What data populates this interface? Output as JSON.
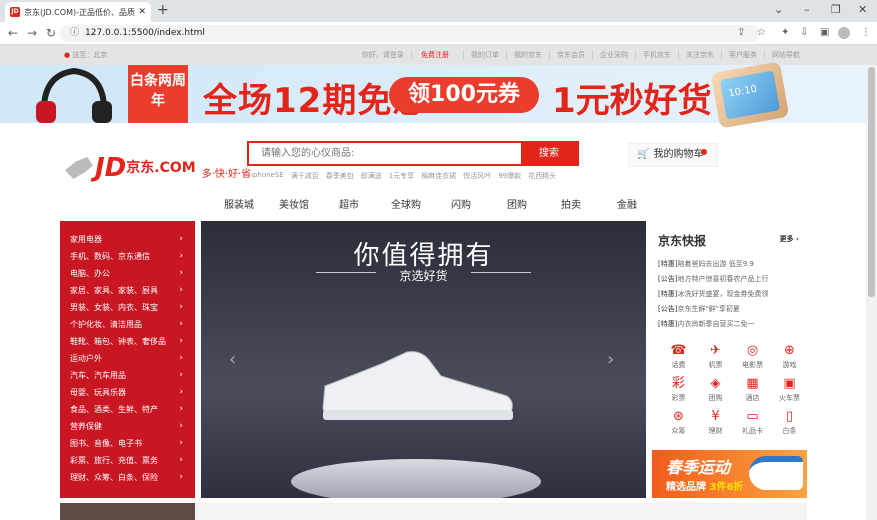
{
  "browser": {
    "tab_title": "京东(JD.COM)-正品低价、品质",
    "url": "127.0.0.1:5500/index.html"
  },
  "shortcut": {
    "location": "送至：北京",
    "greeting": "你好，请登录",
    "register": "免费注册",
    "links": [
      "我的订单",
      "我的京东",
      "京东会员",
      "企业采购",
      "手机京东",
      "关注京东",
      "客户服务",
      "网站导航"
    ]
  },
  "banner": {
    "badge": "白条两周年",
    "big": "全场12期免息",
    "coupon": "领100元券",
    "sec": "1元秒好货",
    "phone_time": "10:10"
  },
  "logo": {
    "jd": "JD",
    "com": "京东.COM",
    "slogan": "多·快·好·省"
  },
  "search": {
    "placeholder": "请输入您的心仪商品:",
    "button": "搜索",
    "hot": [
      "iphoneSE",
      "满千减百",
      "春季美包",
      "即满送",
      "1元专享",
      "棉麻连衣裙",
      "悦活风吟",
      "99爆款",
      "花西精头"
    ]
  },
  "cart": {
    "label": "我的购物车"
  },
  "nav": [
    "服装城",
    "美妆馆",
    "超市",
    "全球购",
    "闪购",
    "团购",
    "拍卖",
    "金融"
  ],
  "categories": [
    "家用电器",
    "手机、数码、京东通信",
    "电脑、办公",
    "家居、家具、家装、厨具",
    "男装、女装、内衣、珠宝",
    "个护化妆、清洁用品",
    "鞋靴、箱包、钟表、奢侈品",
    "运动户外",
    "汽车、汽车用品",
    "母婴、玩具乐器",
    "食品、酒类、生鲜、特产",
    "营养保健",
    "图书、音像、电子书",
    "彩票、旅行、充值、票务",
    "理财、众筹、白条、保险"
  ],
  "slide": {
    "title": "你值得拥有",
    "subtitle": "京选好货"
  },
  "news": {
    "title": "京东快报",
    "more": "更多",
    "items": [
      {
        "tag": "[特惠]",
        "text": "陪着爸妈去出游 低至9.9"
      },
      {
        "tag": "[公告]",
        "text": "地方特产惊喜初春农产品上行"
      },
      {
        "tag": "[特惠]",
        "text": "冰洗好货盛宴，现金券免费领"
      },
      {
        "tag": "[公告]",
        "text": "京东生鲜\"鲜\"享初夏"
      },
      {
        "tag": "[特惠]",
        "text": "内衣尚新季自营买二免一"
      }
    ]
  },
  "services": [
    {
      "icon": "phone-icon",
      "glyph": "☎",
      "label": "话费"
    },
    {
      "icon": "plane-icon",
      "glyph": "✈",
      "label": "机票"
    },
    {
      "icon": "film-icon",
      "glyph": "◎",
      "label": "电影票"
    },
    {
      "icon": "gamepad-icon",
      "glyph": "⊕",
      "label": "游戏"
    },
    {
      "icon": "lottery-icon",
      "glyph": "彩",
      "label": "彩票"
    },
    {
      "icon": "groupbuy-icon",
      "glyph": "◈",
      "label": "团购"
    },
    {
      "icon": "hotel-icon",
      "glyph": "▦",
      "label": "酒店"
    },
    {
      "icon": "train-icon",
      "glyph": "▣",
      "label": "火车票"
    },
    {
      "icon": "crowdfund-icon",
      "glyph": "⊛",
      "label": "众筹"
    },
    {
      "icon": "finance-icon",
      "glyph": "¥",
      "label": "理财"
    },
    {
      "icon": "giftcard-icon",
      "glyph": "▭",
      "label": "礼品卡"
    },
    {
      "icon": "iou-icon",
      "glyph": "▯",
      "label": "白条"
    }
  ],
  "promo": {
    "title": "春季运动",
    "sub1": "精选品牌",
    "sub2": "3件6折"
  }
}
